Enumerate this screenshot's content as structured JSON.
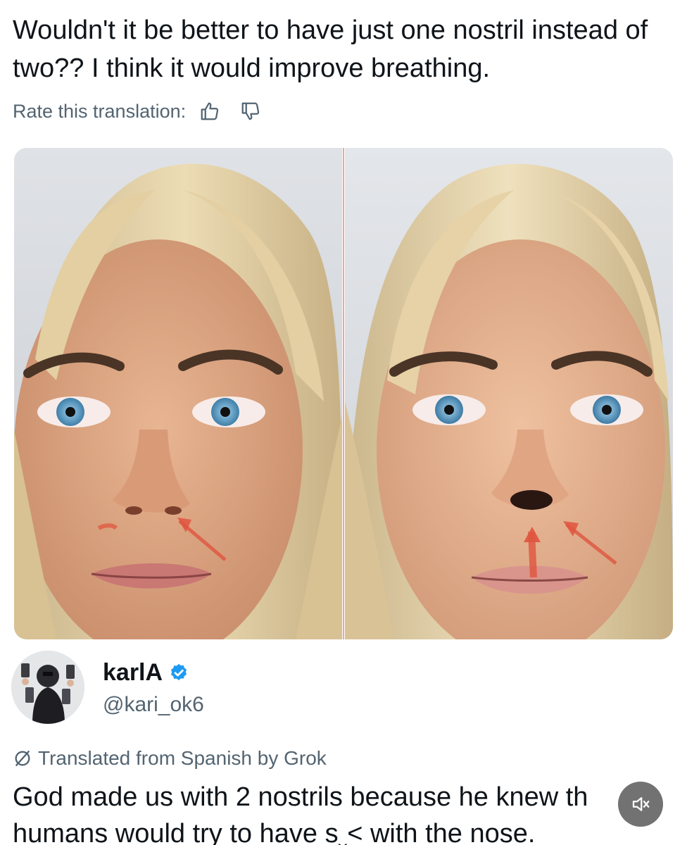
{
  "post": {
    "text": "Wouldn't it be better to have just one nostril instead of two?? I think it would improve breathing.",
    "rate_label": "Rate this translation:",
    "rate_up_icon": "thumbs-up-icon",
    "rate_down_icon": "thumbs-down-icon"
  },
  "media": {
    "panels": [
      "left-face-two-nostrils",
      "right-face-one-nostril"
    ],
    "accent_color": "#e0553f"
  },
  "reply": {
    "author_name": "karlA",
    "author_handle": "@kari_ok6",
    "verified_icon": "verified-badge-icon",
    "verified_color": "#1d9bf0",
    "translated_label": "Translated from Spanish by Grok",
    "translated_icon": "grok-icon",
    "text_line_1": "God made us with 2 nostrils because he knew th",
    "text_line_2": "humans would try to have sˬ˂ with the nose."
  },
  "overlay": {
    "mute_icon": "speaker-muted-icon"
  }
}
